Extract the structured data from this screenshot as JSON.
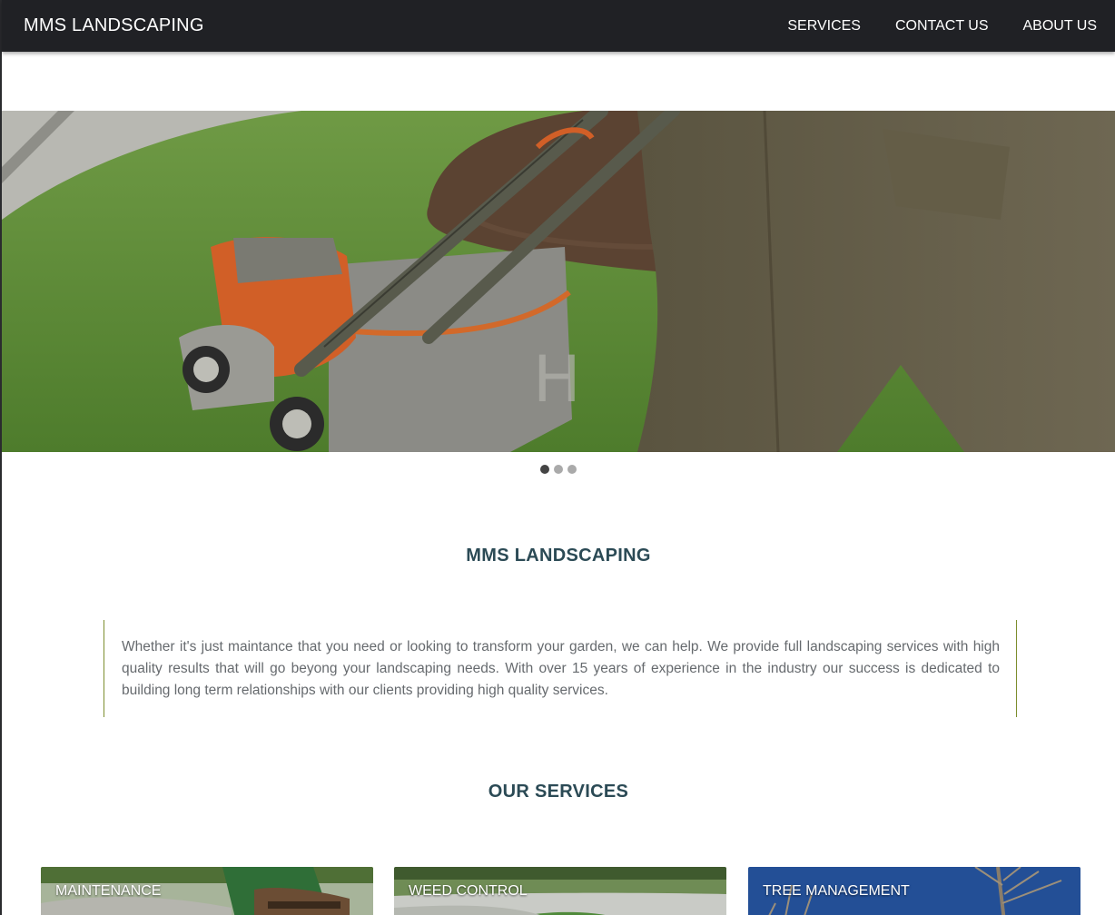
{
  "navbar": {
    "brand": "MMS LANDSCAPING",
    "links": [
      "SERVICES",
      "CONTACT US",
      "ABOUT US"
    ]
  },
  "carousel": {
    "slide_count": 3,
    "active_index": 0
  },
  "about": {
    "title": "MMS LANDSCAPING",
    "text": "Whether it's just maintance that you need or looking to transform your garden, we can help. We provide full landscaping services with high quality results that will go beyong your landscaping needs. With over 15 years of experience in the industry our success is dedicated to building long term relationships with our clients providing high quality services."
  },
  "services": {
    "title": "OUR SERVICES",
    "cards": [
      {
        "label": "MAINTENANCE"
      },
      {
        "label": "WEED CONTROL"
      },
      {
        "label": "TREE MANAGEMENT"
      }
    ]
  },
  "colors": {
    "navbar": "#202125",
    "heading": "#2b4a55",
    "border_accent": "#7d8e2e",
    "body_text": "#666a6e"
  }
}
